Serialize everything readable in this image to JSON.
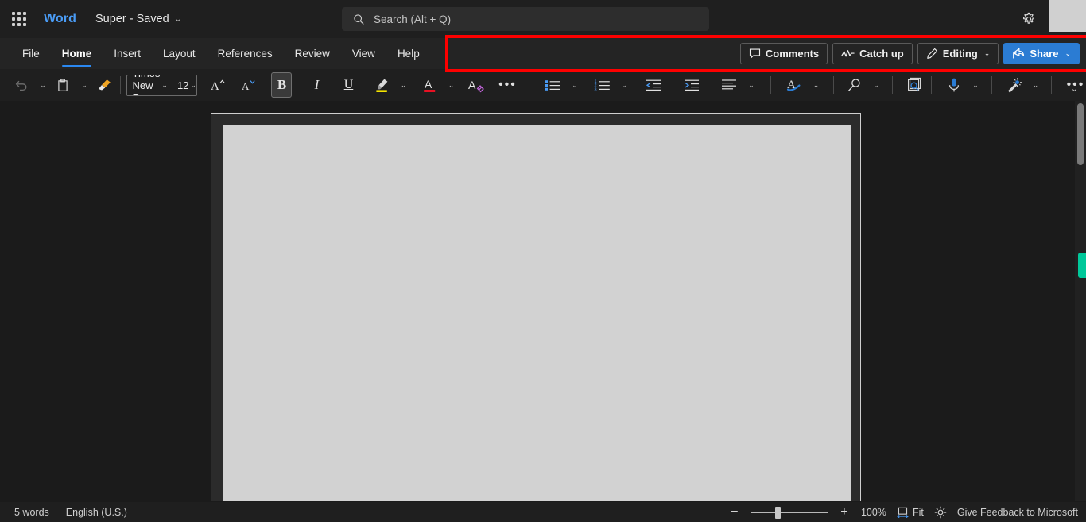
{
  "titlebar": {
    "waffle_label": "app-launcher",
    "app_name": "Word",
    "doc_title": "Super  -  Saved",
    "doc_chevron": "⌄",
    "settings_icon": "gear-icon"
  },
  "search": {
    "placeholder": "Search (Alt + Q)",
    "icon": "search-icon"
  },
  "ribbon": {
    "tabs": [
      {
        "label": "File",
        "active": false
      },
      {
        "label": "Home",
        "active": true
      },
      {
        "label": "Insert",
        "active": false
      },
      {
        "label": "Layout",
        "active": false
      },
      {
        "label": "References",
        "active": false
      },
      {
        "label": "Review",
        "active": false
      },
      {
        "label": "View",
        "active": false
      },
      {
        "label": "Help",
        "active": false
      }
    ],
    "actions": {
      "comments": "Comments",
      "catch_up": "Catch up",
      "editing": "Editing",
      "share": "Share",
      "chevron": "⌄"
    }
  },
  "toolbar": {
    "undo": "undo-icon",
    "paste": "paste-icon",
    "format_painter": "format-painter-icon",
    "font_name": "Times New Ro...",
    "font_size": "12",
    "grow_font": "A",
    "shrink_font": "A",
    "bold": "B",
    "italic": "I",
    "underline": "U",
    "highlight": "text-highlight-icon",
    "font_color": "A",
    "clear_formatting": "clear-formatting-icon",
    "more_font": "•••",
    "bullets": "bullet-list-icon",
    "numbering": "numbered-list-icon",
    "decrease_indent": "decrease-indent-icon",
    "increase_indent": "increase-indent-icon",
    "align": "align-icon",
    "styles": "styles-icon",
    "find": "find-icon",
    "editor": "editor-icon",
    "dictate": "dictate-icon",
    "designer": "designer-icon",
    "more_tools": "•••",
    "collapse": "⌄",
    "chevron": "⌄"
  },
  "statusbar": {
    "word_count": "5 words",
    "language": "English (U.S.)",
    "zoom_out": "−",
    "zoom_in": "+",
    "zoom_level": "100%",
    "fit_label": "Fit",
    "focus_icon": "focus-icon",
    "feedback": "Give Feedback to Microsoft"
  },
  "colors": {
    "accent_blue": "#2b7cd3",
    "tab_underline": "#2b88f0",
    "word_blue": "#4a9cf6",
    "annotation_red": "#fe0000",
    "highlight_yellow": "#f5e400",
    "font_color_red": "#e81123",
    "teal_marker": "#00c89a",
    "page_bg": "#d2d2d2"
  }
}
